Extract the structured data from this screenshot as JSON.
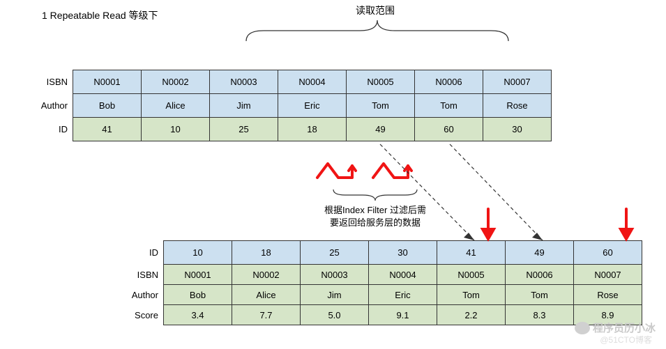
{
  "title": "1 Repeatable Read 等级下",
  "range_label": "读取范围",
  "filter_label_1": "根据Index Filter 过滤后需",
  "filter_label_2": "要返回给服务层的数据",
  "table1": {
    "headers": [
      "ISBN",
      "Author",
      "ID"
    ],
    "rows": [
      [
        "N0001",
        "N0002",
        "N0003",
        "N0004",
        "N0005",
        "N0006",
        "N0007"
      ],
      [
        "Bob",
        "Alice",
        "Jim",
        "Eric",
        "Tom",
        "Tom",
        "Rose"
      ],
      [
        "41",
        "10",
        "25",
        "18",
        "49",
        "60",
        "30"
      ]
    ]
  },
  "table2": {
    "headers": [
      "ID",
      "ISBN",
      "Author",
      "Score"
    ],
    "rows": [
      [
        "10",
        "18",
        "25",
        "30",
        "41",
        "49",
        "60"
      ],
      [
        "N0001",
        "N0002",
        "N0003",
        "N0004",
        "N0005",
        "N0006",
        "N0007"
      ],
      [
        "Bob",
        "Alice",
        "Jim",
        "Eric",
        "Tom",
        "Tom",
        "Rose"
      ],
      [
        "3.4",
        "7.7",
        "5.0",
        "9.1",
        "2.2",
        "8.3",
        "8.9"
      ]
    ]
  },
  "watermark_wx": "程序员历小冰",
  "watermark_cto": "@51CTO博客",
  "chart_data": {
    "type": "table",
    "description": "Diagram showing Repeatable Read isolation level with two related tables. Upper table is an index on (ISBN, Author, ID). A read range bracket covers columns N0004 through N0007. Red lock markers appear on the Tom entries (N0005 ID=49 and N0006 ID=60). Dashed arrows connect those filtered rows (via Index Filter) down to the clustered table rows for ID 41 and 49. Red downward arrows also point at table2 columns for 41 and 49.",
    "upper_table": {
      "columns": [
        "ISBN",
        "Author",
        "ID"
      ],
      "rows": [
        {
          "ISBN": "N0001",
          "Author": "Bob",
          "ID": 41
        },
        {
          "ISBN": "N0002",
          "Author": "Alice",
          "ID": 10
        },
        {
          "ISBN": "N0003",
          "Author": "Jim",
          "ID": 25
        },
        {
          "ISBN": "N0004",
          "Author": "Eric",
          "ID": 18
        },
        {
          "ISBN": "N0005",
          "Author": "Tom",
          "ID": 49
        },
        {
          "ISBN": "N0006",
          "Author": "Tom",
          "ID": 60
        },
        {
          "ISBN": "N0007",
          "Author": "Rose",
          "ID": 30
        }
      ],
      "read_range_isbn": [
        "N0004",
        "N0005",
        "N0006",
        "N0007"
      ],
      "locked_rows_id": [
        49,
        60
      ]
    },
    "lower_table": {
      "columns": [
        "ID",
        "ISBN",
        "Author",
        "Score"
      ],
      "rows": [
        {
          "ID": 10,
          "ISBN": "N0001",
          "Author": "Bob",
          "Score": 3.4
        },
        {
          "ID": 18,
          "ISBN": "N0002",
          "Author": "Alice",
          "Score": 7.7
        },
        {
          "ID": 25,
          "ISBN": "N0003",
          "Author": "Jim",
          "Score": 5.0
        },
        {
          "ID": 30,
          "ISBN": "N0004",
          "Author": "Eric",
          "Score": 9.1
        },
        {
          "ID": 41,
          "ISBN": "N0005",
          "Author": "Tom",
          "Score": 2.2
        },
        {
          "ID": 49,
          "ISBN": "N0006",
          "Author": "Tom",
          "Score": 8.3
        },
        {
          "ID": 60,
          "ISBN": "N0007",
          "Author": "Rose",
          "Score": 8.9
        }
      ],
      "returned_to_server_ids": [
        41,
        49
      ]
    }
  }
}
